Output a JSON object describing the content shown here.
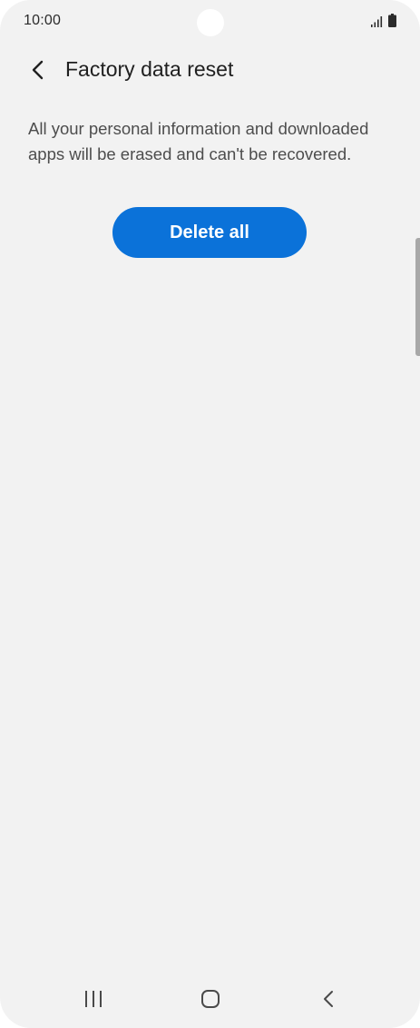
{
  "status_bar": {
    "time": "10:00",
    "icons": [
      "signal-icon",
      "battery-icon"
    ]
  },
  "header": {
    "back_icon": "chevron-left-icon",
    "title": "Factory data reset"
  },
  "main": {
    "description": "All your personal information and downloaded apps will be erased and can't be recovered.",
    "delete_button_label": "Delete all"
  },
  "nav_bar": {
    "items": [
      "recents-icon",
      "home-icon",
      "back-icon"
    ]
  },
  "colors": {
    "background": "#f2f2f2",
    "accent": "#0b72d9",
    "title_text": "#202020",
    "body_text": "#4d4d4d"
  }
}
